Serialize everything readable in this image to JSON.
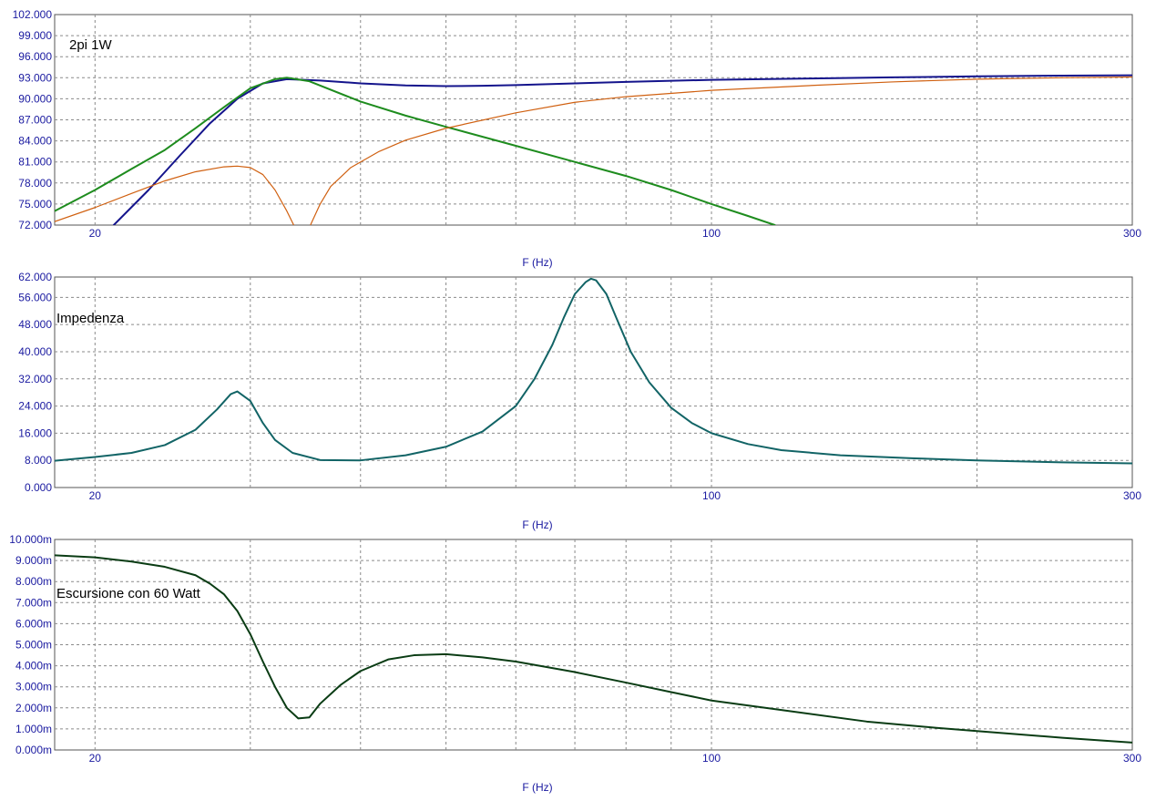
{
  "chart_data": [
    {
      "type": "line",
      "title": "2pi 1W",
      "xlabel": "F (Hz)",
      "ylabel": "",
      "xscale": "log",
      "xlim": [
        18,
        300
      ],
      "ylim": [
        72,
        102
      ],
      "x_tick_labels": [
        "20",
        "100",
        "300"
      ],
      "y_tick_labels": [
        "72.000",
        "75.000",
        "78.000",
        "81.000",
        "84.000",
        "87.000",
        "90.000",
        "93.000",
        "96.000",
        "99.000",
        "102.000"
      ],
      "grid": true,
      "series": [
        {
          "color": "#14148c",
          "points": [
            [
              21,
              72
            ],
            [
              23,
              77
            ],
            [
              25,
              82
            ],
            [
              27,
              86.5
            ],
            [
              29,
              90
            ],
            [
              31,
              92.2
            ],
            [
              33,
              92.8
            ],
            [
              36,
              92.6
            ],
            [
              40,
              92.2
            ],
            [
              45,
              91.9
            ],
            [
              50,
              91.8
            ],
            [
              55,
              91.85
            ],
            [
              60,
              91.95
            ],
            [
              70,
              92.2
            ],
            [
              80,
              92.4
            ],
            [
              100,
              92.7
            ],
            [
              130,
              92.9
            ],
            [
              160,
              93.05
            ],
            [
              200,
              93.2
            ],
            [
              250,
              93.3
            ],
            [
              300,
              93.35
            ]
          ]
        },
        {
          "color": "#1e8c1e",
          "points": [
            [
              18,
              74
            ],
            [
              20,
              77
            ],
            [
              22,
              80
            ],
            [
              24,
              82.7
            ],
            [
              26,
              85.8
            ],
            [
              28,
              88.8
            ],
            [
              30,
              91.5
            ],
            [
              32,
              92.8
            ],
            [
              33,
              93
            ],
            [
              35,
              92.5
            ],
            [
              40,
              89.6
            ],
            [
              45,
              87.6
            ],
            [
              50,
              86
            ],
            [
              60,
              83.3
            ],
            [
              70,
              81
            ],
            [
              80,
              79
            ],
            [
              90,
              77
            ],
            [
              100,
              75
            ],
            [
              110,
              73.3
            ],
            [
              118,
              72
            ]
          ]
        },
        {
          "color": "#d06010",
          "segments": [
            [
              [
                18,
                72.5
              ],
              [
                20,
                74.5
              ],
              [
                22,
                76.5
              ],
              [
                24,
                78.3
              ],
              [
                26,
                79.6
              ],
              [
                28,
                80.3
              ],
              [
                29,
                80.4
              ],
              [
                30,
                80.2
              ],
              [
                31,
                79.2
              ],
              [
                32,
                77
              ],
              [
                33,
                74
              ],
              [
                33.6,
                72
              ]
            ],
            [
              [
                35.1,
                72
              ],
              [
                36,
                75
              ],
              [
                37,
                77.5
              ],
              [
                39,
                80.2
              ],
              [
                42,
                82.5
              ],
              [
                45,
                84.1
              ],
              [
                50,
                85.8
              ],
              [
                60,
                88
              ],
              [
                70,
                89.5
              ],
              [
                80,
                90.3
              ],
              [
                100,
                91.2
              ],
              [
                130,
                91.9
              ],
              [
                160,
                92.4
              ],
              [
                200,
                92.8
              ],
              [
                250,
                93
              ],
              [
                300,
                93.1
              ]
            ]
          ]
        }
      ]
    },
    {
      "type": "line",
      "title": "Impedenza",
      "xlabel": "F (Hz)",
      "ylabel": "",
      "xscale": "log",
      "xlim": [
        18,
        300
      ],
      "ylim": [
        0,
        62
      ],
      "x_tick_labels": [
        "20",
        "100",
        "300"
      ],
      "y_tick_labels": [
        "0.000",
        "8.000",
        "16.000",
        "24.000",
        "32.000",
        "40.000",
        "48.000",
        "56.000",
        "62.000"
      ],
      "grid": true,
      "series": [
        {
          "color": "#126466",
          "points": [
            [
              18,
              7.9
            ],
            [
              20,
              9
            ],
            [
              22,
              10.2
            ],
            [
              24,
              12.5
            ],
            [
              26,
              17
            ],
            [
              27.5,
              23
            ],
            [
              28.5,
              27.5
            ],
            [
              29,
              28.3
            ],
            [
              30,
              25.5
            ],
            [
              31,
              19
            ],
            [
              32,
              14
            ],
            [
              33.5,
              10.2
            ],
            [
              36,
              8.1
            ],
            [
              40,
              8
            ],
            [
              45,
              9.5
            ],
            [
              50,
              12
            ],
            [
              55,
              16.5
            ],
            [
              60,
              24
            ],
            [
              63,
              32
            ],
            [
              66,
              42
            ],
            [
              68,
              50
            ],
            [
              70,
              57
            ],
            [
              72,
              60.5
            ],
            [
              73,
              61.5
            ],
            [
              74,
              61
            ],
            [
              76,
              57
            ],
            [
              78,
              50
            ],
            [
              81,
              40
            ],
            [
              85,
              31
            ],
            [
              90,
              23.5
            ],
            [
              95,
              19
            ],
            [
              100,
              16
            ],
            [
              110,
              12.8
            ],
            [
              120,
              11
            ],
            [
              140,
              9.5
            ],
            [
              170,
              8.6
            ],
            [
              200,
              8
            ],
            [
              250,
              7.4
            ],
            [
              300,
              7.1
            ]
          ]
        }
      ]
    },
    {
      "type": "line",
      "title": "Escursione con 60 Watt",
      "xlabel": "F (Hz)",
      "ylabel": "",
      "xscale": "log",
      "xlim": [
        18,
        300
      ],
      "ylim": [
        0,
        10
      ],
      "x_tick_labels": [
        "20",
        "100",
        "300"
      ],
      "y_tick_labels": [
        "0.000m",
        "1.000m",
        "2.000m",
        "3.000m",
        "4.000m",
        "5.000m",
        "6.000m",
        "7.000m",
        "8.000m",
        "9.000m",
        "10.000m"
      ],
      "grid": true,
      "series": [
        {
          "color": "#0a3c14",
          "points": [
            [
              18,
              9.25
            ],
            [
              20,
              9.15
            ],
            [
              22,
              8.95
            ],
            [
              24,
              8.7
            ],
            [
              26,
              8.3
            ],
            [
              27,
              7.9
            ],
            [
              28,
              7.4
            ],
            [
              29,
              6.6
            ],
            [
              30,
              5.5
            ],
            [
              31,
              4.2
            ],
            [
              32,
              3
            ],
            [
              33,
              2
            ],
            [
              34,
              1.5
            ],
            [
              35,
              1.55
            ],
            [
              36,
              2.2
            ],
            [
              38,
              3.1
            ],
            [
              40,
              3.75
            ],
            [
              43,
              4.3
            ],
            [
              46,
              4.5
            ],
            [
              50,
              4.55
            ],
            [
              55,
              4.4
            ],
            [
              60,
              4.2
            ],
            [
              70,
              3.7
            ],
            [
              80,
              3.2
            ],
            [
              90,
              2.75
            ],
            [
              100,
              2.35
            ],
            [
              120,
              1.9
            ],
            [
              150,
              1.35
            ],
            [
              180,
              1.05
            ],
            [
              200,
              0.9
            ],
            [
              250,
              0.58
            ],
            [
              300,
              0.35
            ]
          ]
        }
      ]
    }
  ]
}
